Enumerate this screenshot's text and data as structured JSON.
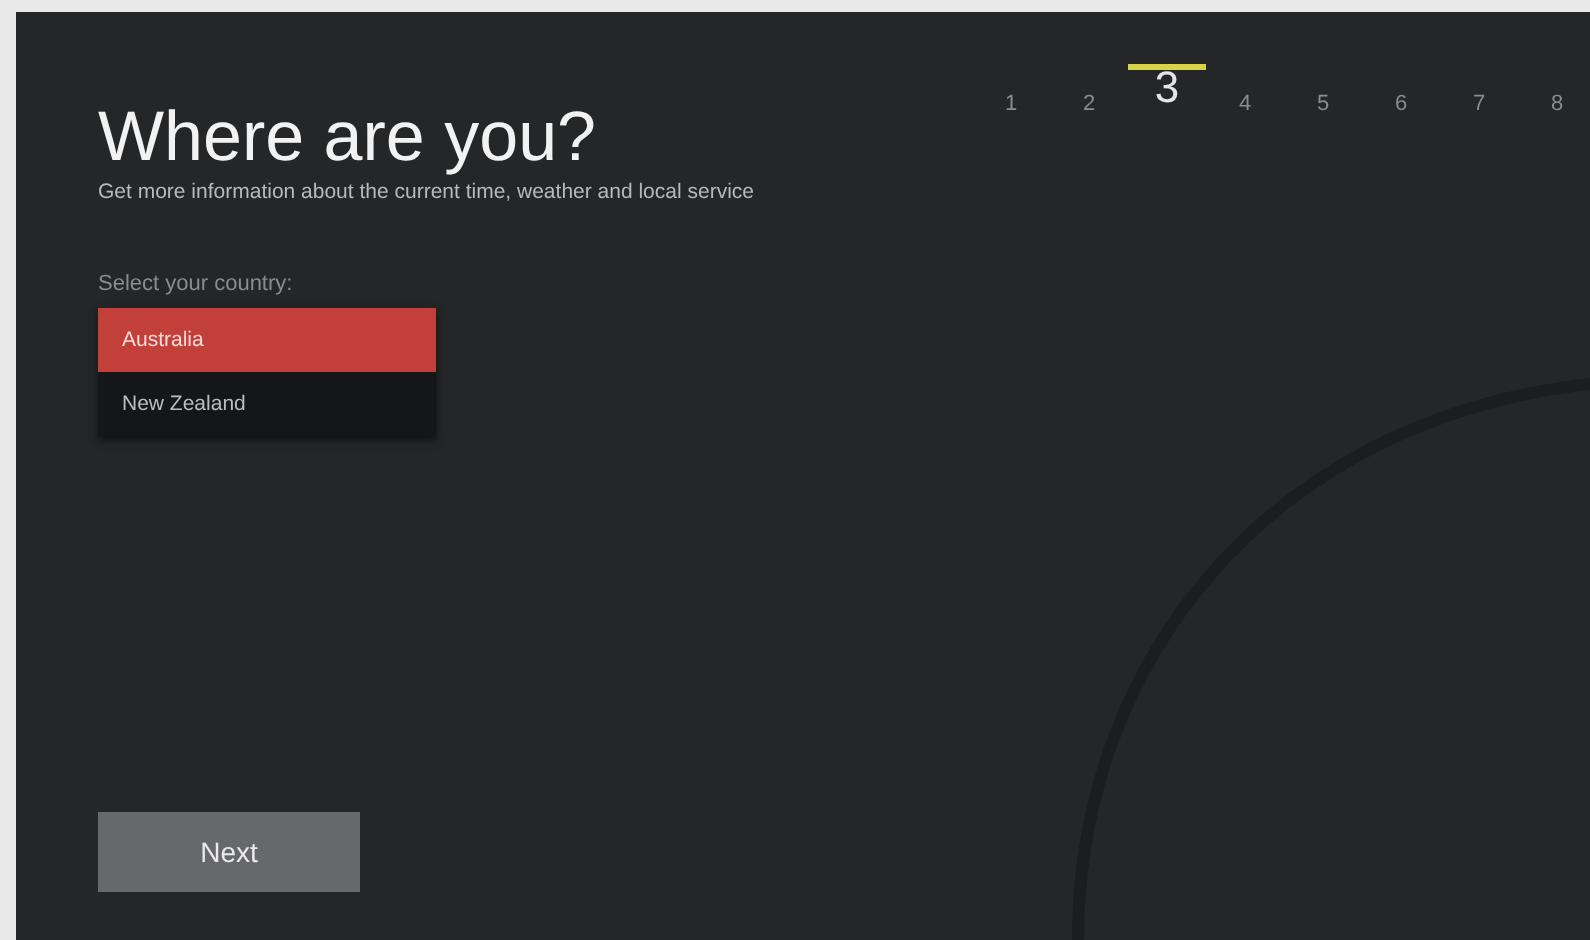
{
  "title": "Where are you?",
  "subtitle": "Get more information about the current time, weather and local service",
  "steps": [
    {
      "label": "1",
      "selected": false
    },
    {
      "label": "2",
      "selected": false
    },
    {
      "label": "3",
      "selected": true
    },
    {
      "label": "4",
      "selected": false
    },
    {
      "label": "5",
      "selected": false
    },
    {
      "label": "6",
      "selected": false
    },
    {
      "label": "7",
      "selected": false
    },
    {
      "label": "8",
      "selected": false
    }
  ],
  "country_label": "Select your country:",
  "countries": [
    {
      "label": "Australia",
      "selected": true
    },
    {
      "label": "New Zealand",
      "selected": false
    }
  ],
  "next_button": "Next"
}
